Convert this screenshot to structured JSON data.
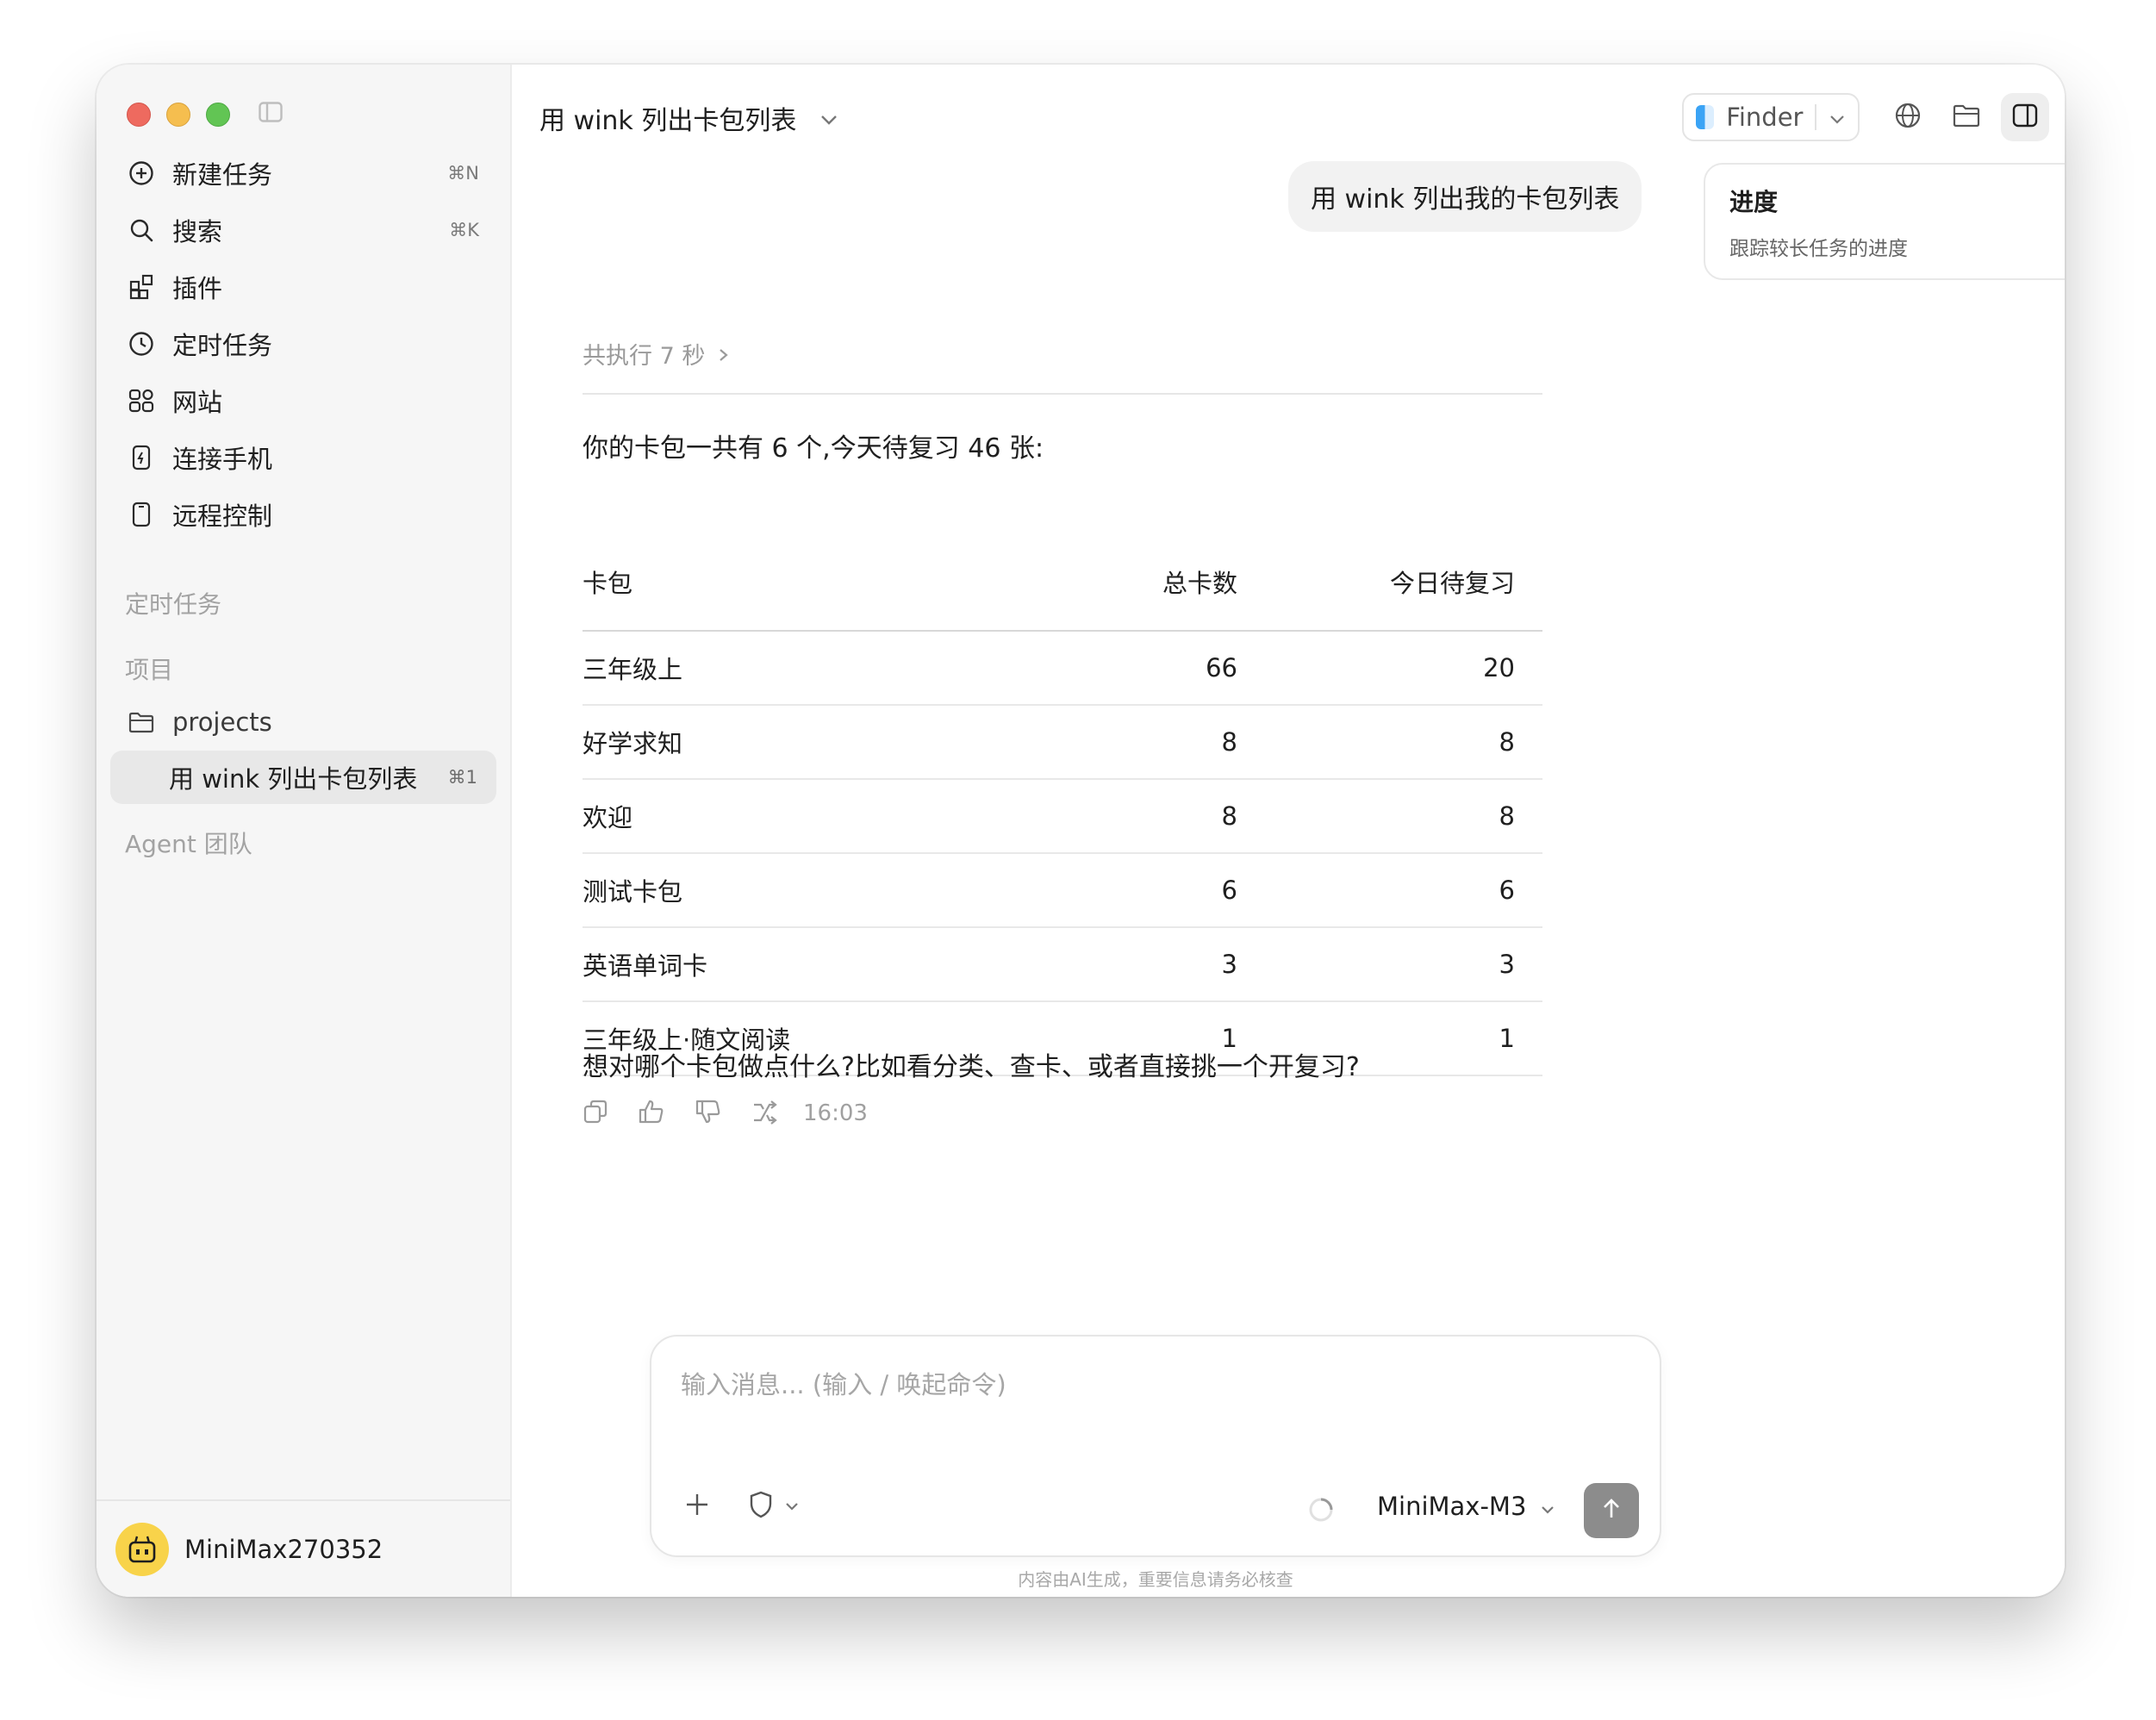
{
  "window": {
    "title": "用 wink 列出卡包列表"
  },
  "sidebar": {
    "nav": [
      {
        "label": "新建任务",
        "shortcut": "⌘N",
        "icon": "plus-circle-icon"
      },
      {
        "label": "搜索",
        "shortcut": "⌘K",
        "icon": "search-icon"
      },
      {
        "label": "插件",
        "shortcut": "",
        "icon": "plugin-icon"
      },
      {
        "label": "定时任务",
        "shortcut": "",
        "icon": "clock-icon"
      },
      {
        "label": "网站",
        "shortcut": "",
        "icon": "website-icon"
      },
      {
        "label": "连接手机",
        "shortcut": "",
        "icon": "phone-icon"
      },
      {
        "label": "远程控制",
        "shortcut": "",
        "icon": "tablet-icon"
      }
    ],
    "section_scheduled": "定时任务",
    "section_projects": "项目",
    "project": {
      "label": "projects",
      "icon": "folder-icon"
    },
    "task": {
      "label": "用 wink 列出卡包列表",
      "shortcut": "⌘1"
    },
    "section_agents": "Agent 团队",
    "user": {
      "name": "MiniMax270352"
    }
  },
  "topbar": {
    "title": "用 wink 列出卡包列表",
    "finder_label": "Finder"
  },
  "chat": {
    "user_message": "用 wink 列出我的卡包列表",
    "exec_time": "共执行 7 秒",
    "intro": "你的卡包一共有 6 个,今天待复习 46 张:",
    "table": {
      "headers": [
        "卡包",
        "总卡数",
        "今日待复习"
      ],
      "rows": [
        [
          "三年级上",
          "66",
          "20"
        ],
        [
          "好学求知",
          "8",
          "8"
        ],
        [
          "欢迎",
          "8",
          "8"
        ],
        [
          "测试卡包",
          "6",
          "6"
        ],
        [
          "英语单词卡",
          "3",
          "3"
        ],
        [
          "三年级上·随文阅读",
          "1",
          "1"
        ]
      ]
    },
    "question": "想对哪个卡包做点什么?比如看分类、查卡、或者直接挑一个开复习?",
    "time": "16:03"
  },
  "progress": {
    "title": "进度",
    "subtitle": "跟踪较长任务的进度"
  },
  "composer": {
    "placeholder": "输入消息... (输入 / 唤起命令)",
    "model": "MiniMax-M3"
  },
  "disclaimer": "内容由AI生成，重要信息请务必核查"
}
